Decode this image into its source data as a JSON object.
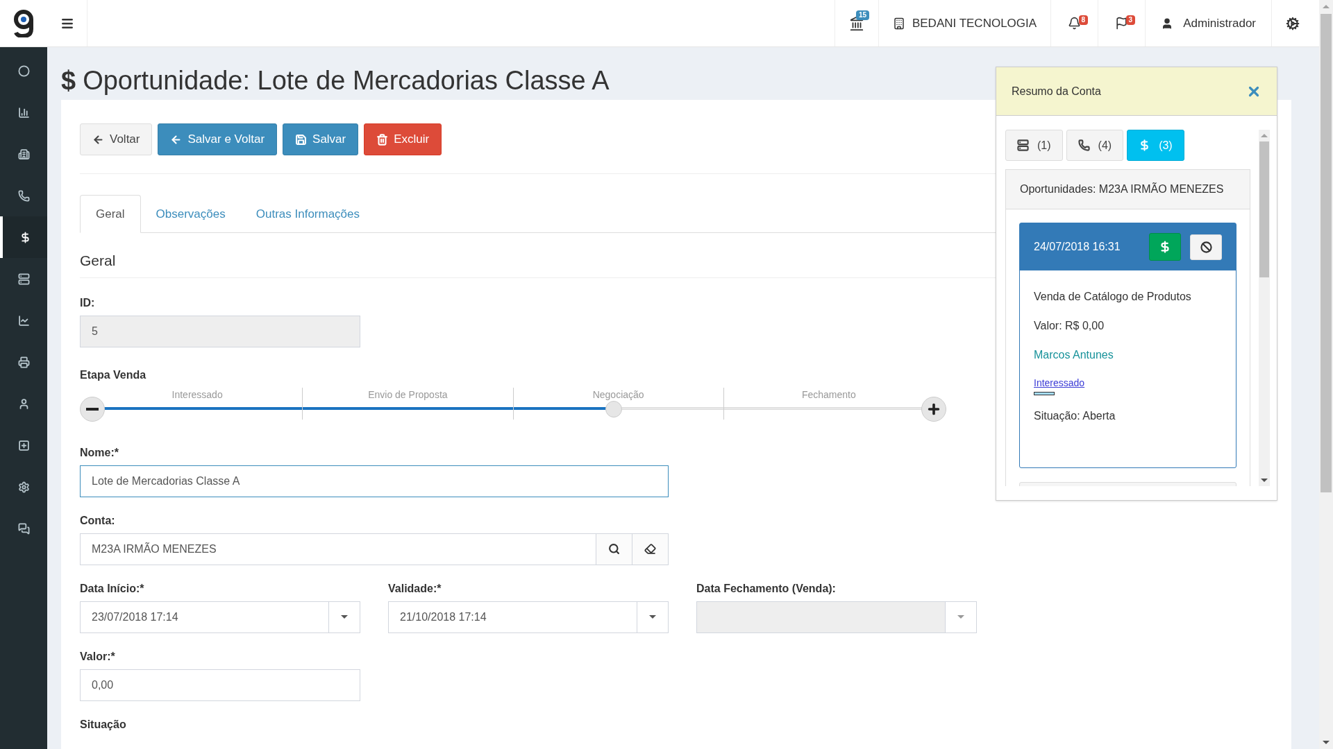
{
  "topbar": {
    "bank_badge": "15",
    "company": "BEDANI TECNOLOGIA",
    "bell_badge": "8",
    "flag_badge": "3",
    "user": "Administrador"
  },
  "sidebar": {
    "items": [
      {
        "selected": false
      },
      {
        "selected": false
      },
      {
        "selected": false
      },
      {
        "selected": false
      },
      {
        "selected": true
      },
      {
        "selected": false
      },
      {
        "selected": false
      },
      {
        "selected": false
      },
      {
        "selected": false
      },
      {
        "selected": false
      },
      {
        "selected": false
      },
      {
        "selected": false
      }
    ]
  },
  "page": {
    "icon": "$",
    "title": "Oportunidade: Lote de Mercadorias Classe A"
  },
  "actions": [
    {
      "kind": "back",
      "label": "Voltar"
    },
    {
      "kind": "save_back",
      "label": "Salvar e Voltar"
    },
    {
      "kind": "save",
      "label": "Salvar"
    },
    {
      "kind": "delete",
      "label": "Excluir"
    }
  ],
  "tabs": [
    {
      "label": "Geral",
      "selected": true
    },
    {
      "label": "Observações",
      "selected": false
    },
    {
      "label": "Outras Informações",
      "selected": false
    }
  ],
  "section_title": "Geral",
  "form": {
    "id": {
      "label": "ID:",
      "value": "5"
    },
    "stage": {
      "label": "Etapa Venda",
      "steps": [
        "Interessado",
        "Envio de Proposta",
        "Negociação",
        "Fechamento"
      ],
      "level": 0.62
    },
    "name": {
      "label": "Nome:*",
      "value": "Lote de Mercadorias Classe A"
    },
    "account": {
      "label": "Conta:",
      "value": "M23A IRMÃO MENEZES"
    },
    "dates": [
      {
        "label": "Data Início:*",
        "value": "23/07/2018 17:14",
        "disabled": false
      },
      {
        "label": "Validade:*",
        "value": "21/10/2018 17:14",
        "disabled": false
      },
      {
        "label": "Data Fechamento (Venda):",
        "disabled": true
      }
    ],
    "value": {
      "label": "Valor:*",
      "value": "0,00"
    },
    "status": {
      "label": "Situação"
    }
  },
  "panel": {
    "title": "Resumo da Conta",
    "tabs": [
      {
        "kind": "list",
        "label": "(1)",
        "selected": false
      },
      {
        "kind": "phone",
        "label": "(4)",
        "selected": false
      },
      {
        "kind": "money",
        "label": "(3)",
        "selected": true
      }
    ],
    "heading": "Oportunidades: M23A IRMÃO MENEZES",
    "card": {
      "date": "24/07/2018 16:31",
      "name": "Venda de Catálogo de Produtos",
      "value": "Valor: R$ 0,00",
      "contact": "Marcos Antunes",
      "stage": "Interessado",
      "stage_bar": {
        "level": 0.35
      },
      "status": "Situação: Aberta"
    }
  }
}
